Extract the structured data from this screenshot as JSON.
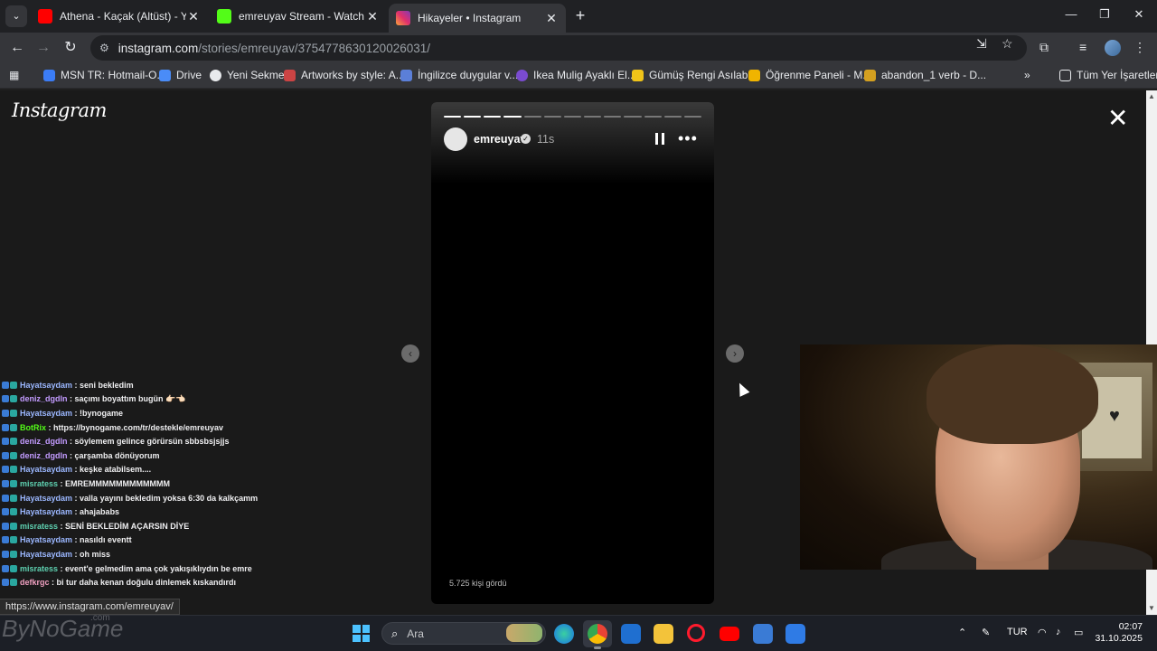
{
  "browser": {
    "tabs": [
      {
        "title": "Athena - Kaçak (Altüst) - YouTube",
        "favicon_color": "#ff0000",
        "active": false
      },
      {
        "title": "emreuyav Stream - Watch Live on Kick",
        "favicon_color": "#53fc18",
        "active": false
      },
      {
        "title": "Hikayeler • Instagram",
        "favicon_color": "#e1306c",
        "active": true
      }
    ],
    "url_host": "instagram.com",
    "url_path": "/stories/emreuyav/3754778630120026031/",
    "bookmarks": [
      {
        "label": "MSN TR: Hotmail-O...",
        "color": "#3b7cf5"
      },
      {
        "label": "Drive",
        "color": "#4a8cf7"
      },
      {
        "label": "Yeni Sekme",
        "color": "#e8eaed"
      },
      {
        "label": "Artworks by style: A...",
        "color": "#c44"
      },
      {
        "label": "İngilizce duygular v...",
        "color": "#5b7fd8"
      },
      {
        "label": "Ikea Mulig Ayaklı El...",
        "color": "#7a4bd0"
      },
      {
        "label": "Gümüş Rengi Asılab...",
        "color": "#f0c419"
      },
      {
        "label": "Öğrenme Paneli - M...",
        "color": "#f0b400"
      },
      {
        "label": "abandon_1 verb - D...",
        "color": "#d4a020"
      }
    ],
    "bookmarks_more": "»",
    "all_bookmarks": "Tüm Yer İşaretleri",
    "status_url": "https://www.instagram.com/emreuyav/"
  },
  "instagram": {
    "logo": "Instagram",
    "story": {
      "username": "emreuyav",
      "time": "11s",
      "viewers": "5.725 kişi gördü",
      "segments_total": 13,
      "segments_done": 4
    }
  },
  "chat": [
    {
      "user": "Hayatsaydam",
      "msg": "seni bekledim",
      "color": "#9bb7ff"
    },
    {
      "user": "deniz_dgdln",
      "msg": "saçımı boyattım bugün 👉🏻👈🏻",
      "color": "#c39bff"
    },
    {
      "user": "Hayatsaydam",
      "msg": "!bynogame",
      "color": "#9bb7ff"
    },
    {
      "user": "BotRix",
      "msg": "https://bynogame.com/tr/destekle/emreuyav",
      "color": "#53fc18"
    },
    {
      "user": "deniz_dgdln",
      "msg": "söylemem gelince görürsün sbbsbsjsjjs",
      "color": "#c39bff"
    },
    {
      "user": "deniz_dgdln",
      "msg": "çarşamba dönüyorum",
      "color": "#c39bff"
    },
    {
      "user": "Hayatsaydam",
      "msg": "keşke atabilsem....",
      "color": "#9bb7ff"
    },
    {
      "user": "misratess",
      "msg": "EMREMMMMMMMMMMMM",
      "color": "#5ed0b0"
    },
    {
      "user": "Hayatsaydam",
      "msg": "valla yayını bekledim yoksa 6:30 da kalkçamm",
      "color": "#9bb7ff"
    },
    {
      "user": "Hayatsaydam",
      "msg": "ahajababs",
      "color": "#9bb7ff"
    },
    {
      "user": "misratess",
      "msg": "SENİ BEKLEDİM AÇARSIN DİYE",
      "color": "#5ed0b0"
    },
    {
      "user": "Hayatsaydam",
      "msg": "nasıldı eventt",
      "color": "#9bb7ff"
    },
    {
      "user": "Hayatsaydam",
      "msg": "oh miss",
      "color": "#9bb7ff"
    },
    {
      "user": "misratess",
      "msg": "event'e gelmedim ama çok yakışıklıydın be emre",
      "color": "#5ed0b0"
    },
    {
      "user": "defkrgc",
      "msg": "bi tur daha kenan doğulu dinlemek kıskandırdı",
      "color": "#f0a0c0"
    }
  ],
  "taskbar": {
    "watermark": "ByNoGame",
    "watermark_sub": ".com",
    "search_placeholder": "Ara",
    "lang": "TUR",
    "time": "02:07",
    "date": "31.10.2025"
  }
}
